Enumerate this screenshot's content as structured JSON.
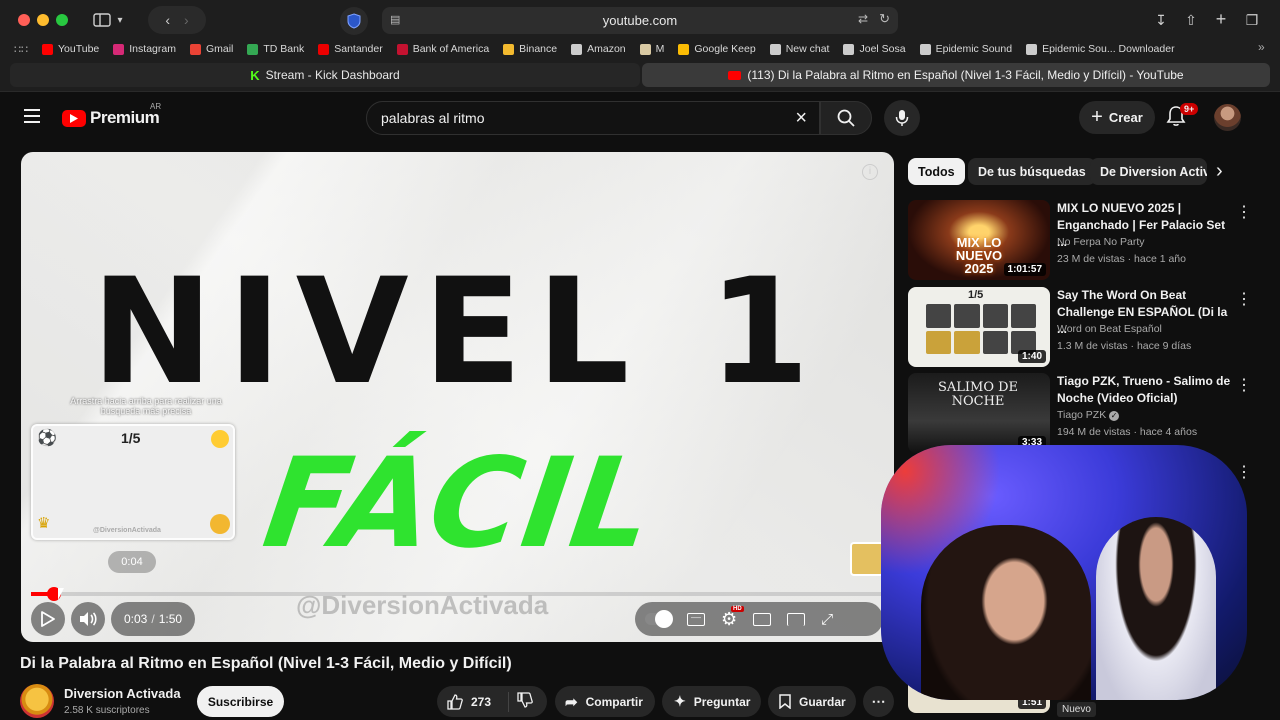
{
  "browser": {
    "url": "youtube.com",
    "bookmarks": [
      {
        "label": "YouTube",
        "color": "#ff0000"
      },
      {
        "label": "Instagram",
        "color": "#d62976"
      },
      {
        "label": "Gmail",
        "color": "#ea4335"
      },
      {
        "label": "TD Bank",
        "color": "#34a853"
      },
      {
        "label": "Santander",
        "color": "#ec0000"
      },
      {
        "label": "Bank of America",
        "color": "#c41230"
      },
      {
        "label": "Binance",
        "color": "#f3ba2f"
      },
      {
        "label": "Amazon",
        "color": "#cccccc"
      },
      {
        "label": "M",
        "color": "#d9c9a3"
      },
      {
        "label": "Google Keep",
        "color": "#fbbc04"
      },
      {
        "label": "New chat",
        "color": "#cccccc"
      },
      {
        "label": "Joel Sosa",
        "color": "#cccccc"
      },
      {
        "label": "Epidemic Sound",
        "color": "#cccccc"
      },
      {
        "label": "Epidemic Sou... Downloader",
        "color": "#cccccc"
      }
    ],
    "tabs": [
      {
        "label": "Stream - Kick Dashboard",
        "active": false
      },
      {
        "label": "(113) Di la Palabra al Ritmo en Español (Nivel 1-3 Fácil, Medio y Difícil) - YouTube",
        "active": true
      }
    ]
  },
  "header": {
    "logo_text": "Premium",
    "region": "AR",
    "search_value": "palabras al ritmo",
    "create_label": "Crear",
    "notif_count": "9+"
  },
  "player": {
    "overlay_line1": "NIVEL 1",
    "overlay_line2": "FÁCIL",
    "watermark": "@DiversionActivada",
    "scrub_hint": "Arrastra hacia arriba para realizar una búsqueda más precisa",
    "preview_counter": "1/5",
    "preview_watermark": "@DiversionActivada",
    "preview_time": "0:04",
    "current_time": "0:03",
    "duration": "1:50",
    "progress_fraction": 0.027
  },
  "video": {
    "title": "Di la Palabra al Ritmo en Español (Nivel 1-3 Fácil, Medio y Difícil)",
    "channel": "Diversion Activada",
    "subscribers": "2.58 K suscriptores",
    "subscribe_label": "Suscribirse",
    "likes": "273",
    "share_label": "Compartir",
    "ask_label": "Preguntar",
    "save_label": "Guardar"
  },
  "sidebar": {
    "chips": [
      "Todos",
      "De tus búsquedas",
      "De Diversion Activa"
    ],
    "recs": [
      {
        "title": "MIX LO NUEVO 2025 | Enganchado | Fer Palacio Set ...",
        "channel": "No Ferpa No Party",
        "meta": "23 M de vistas · hace 1 año",
        "duration": "1:01:57",
        "thumb_text": "MIX LO NUEVO 2025"
      },
      {
        "title": "Say The Word On Beat Challenge EN ESPAÑOL (Di la ...",
        "channel": "Word on Beat Español",
        "meta": "1.3 M de vistas · hace 9 días",
        "duration": "1:40",
        "thumb_text": "1/5"
      },
      {
        "title": "Tiago PZK, Trueno - Salimo de Noche (Video Oficial)",
        "channel": "Tiago PZK",
        "meta": "194 M de vistas · hace 4 años",
        "duration": "3:33",
        "thumb_text": "SALIMO DE NOCHE"
      }
    ],
    "partial_duration": "1:51",
    "partial_badge": "Nuevo"
  }
}
